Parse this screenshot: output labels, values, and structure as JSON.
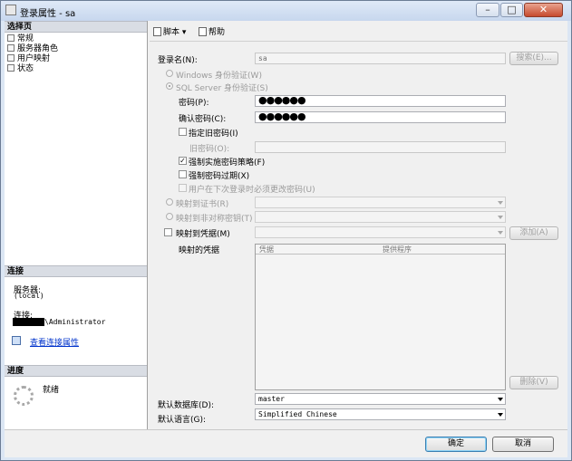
{
  "window": {
    "title": "登录属性 - sa"
  },
  "left": {
    "select_page": {
      "header": "选择页",
      "items": [
        {
          "label": "常规"
        },
        {
          "label": "服务器角色"
        },
        {
          "label": "用户映射"
        },
        {
          "label": "状态"
        }
      ]
    },
    "connection": {
      "header": "连接",
      "server_label": "服务器:",
      "server_value": "(local)",
      "conn_label": "连接:",
      "conn_value": "\\Administrator",
      "view_link": "查看连接属性"
    },
    "progress": {
      "header": "进度",
      "status": "就绪"
    }
  },
  "toolbar": {
    "script_label": "脚本",
    "help_label": "帮助"
  },
  "form": {
    "login_name_label": "登录名(N):",
    "login_name_value": "sa",
    "search_button": "搜索(E)...",
    "windows_auth": "Windows 身份验证(W)",
    "sql_auth": "SQL Server 身份验证(S)",
    "password_label": "密码(P):",
    "password_value": "●●●●●●",
    "confirm_label": "确认密码(C):",
    "confirm_value": "●●●●●●",
    "specify_old": "指定旧密码(I)",
    "old_password_label": "旧密码(O):",
    "enforce_policy": "强制实施密码策略(F)",
    "enforce_expiration": "强制密码过期(X)",
    "must_change": "用户在下次登录时必须更改密码(U)",
    "map_cert": "映射到证书(R)",
    "map_key": "映射到非对称密钥(T)",
    "map_credential": "映射到凭据(M)",
    "add_button": "添加(A)",
    "mapped_cred_label": "映射的凭据",
    "grid_col_cred": "凭据",
    "grid_col_provider": "提供程序",
    "remove_button": "删除(V)",
    "default_db_label": "默认数据库(D):",
    "default_db_value": "master",
    "default_lang_label": "默认语言(G):",
    "default_lang_value": "Simplified Chinese"
  },
  "state": {
    "sql_auth_selected": true,
    "enforce_policy_checked": true,
    "enforce_expiration_checked": false,
    "specify_old_checked": false
  },
  "footer": {
    "ok_button": "确定",
    "cancel_button": "取消"
  }
}
